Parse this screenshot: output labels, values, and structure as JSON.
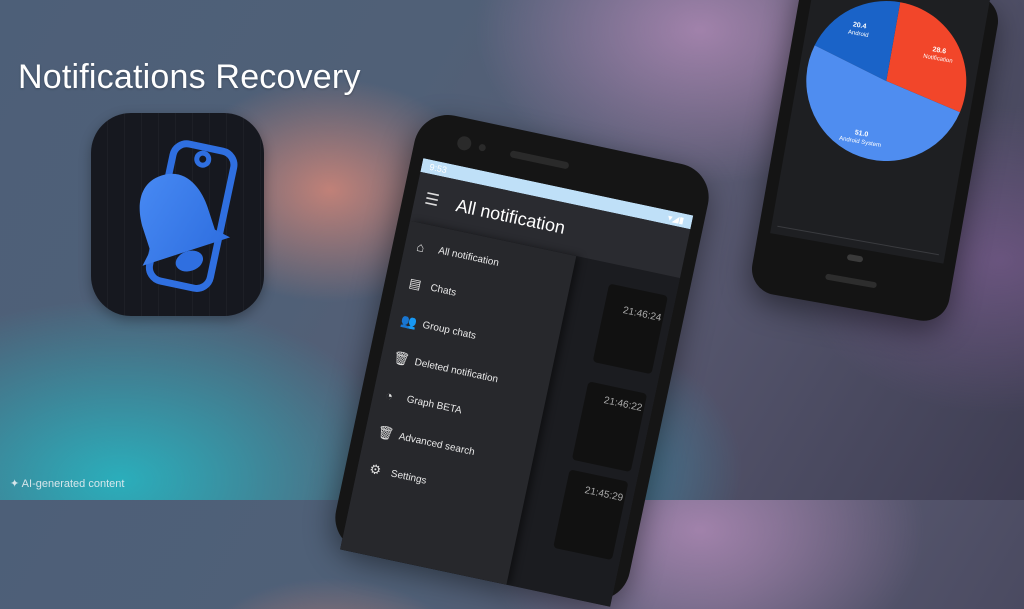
{
  "promo": {
    "title": "Notifications Recovery",
    "ai_badge": "AI-generated content"
  },
  "phone_main": {
    "status_time": "9:53",
    "appbar_title": "All notification",
    "drawer_items": [
      {
        "label": "All notification",
        "icon": "home-icon"
      },
      {
        "label": "Chats",
        "icon": "chat-icon"
      },
      {
        "label": "Group chats",
        "icon": "group-icon"
      },
      {
        "label": "Deleted notification",
        "icon": "trash-icon"
      },
      {
        "label": "Graph BETA",
        "icon": "pie-chart-icon"
      },
      {
        "label": "Advanced search",
        "icon": "trash-icon"
      },
      {
        "label": "Settings",
        "icon": "gear-icon"
      }
    ],
    "list_times": [
      "21:46:24",
      "21:46:22",
      "21:45:29"
    ]
  },
  "chart_data": {
    "type": "pie",
    "slices": [
      {
        "label": "Notification",
        "value": 28.6,
        "color": "#f2462a"
      },
      {
        "label": "Android System",
        "value": 51.0,
        "color": "#4f8df0"
      },
      {
        "label": "Android",
        "value": 20.4,
        "color": "#1a63c8"
      }
    ]
  },
  "colors": {
    "statusbar": "#bfe0f8",
    "icon_blue": "#3d7df0",
    "screen_bg": "#212226"
  }
}
